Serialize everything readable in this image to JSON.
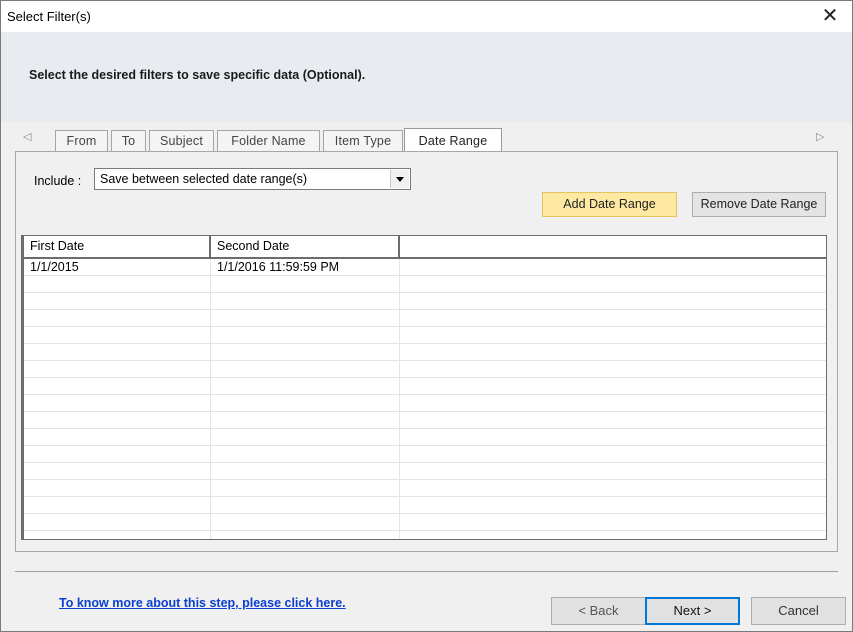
{
  "window": {
    "title": "Select Filter(s)",
    "close_glyph": "✕"
  },
  "instruction": "Select the desired filters to save specific data (Optional).",
  "tabs": {
    "left_arrow": "◁",
    "right_arrow": "▷",
    "items": [
      {
        "label": "From"
      },
      {
        "label": "To"
      },
      {
        "label": "Subject"
      },
      {
        "label": "Folder Name"
      },
      {
        "label": "Item Type"
      },
      {
        "label": "Date Range",
        "active": true
      }
    ]
  },
  "date_range": {
    "include_label": "Include :",
    "include_value": "Save between selected date range(s)",
    "add_button": "Add Date Range",
    "remove_button": "Remove Date Range",
    "columns": [
      "First Date",
      "Second Date"
    ],
    "rows": [
      {
        "first_date": "1/1/2015",
        "second_date": "1/1/2016 11:59:59 PM"
      }
    ]
  },
  "footer": {
    "help_link": "To know more about this step, please click here.",
    "back_button": "< Back",
    "next_button": "Next >",
    "cancel_button": "Cancel"
  },
  "colors": {
    "accent_button": "#fde9a1",
    "link": "#0b3fd1",
    "focus_border": "#0078d7"
  }
}
